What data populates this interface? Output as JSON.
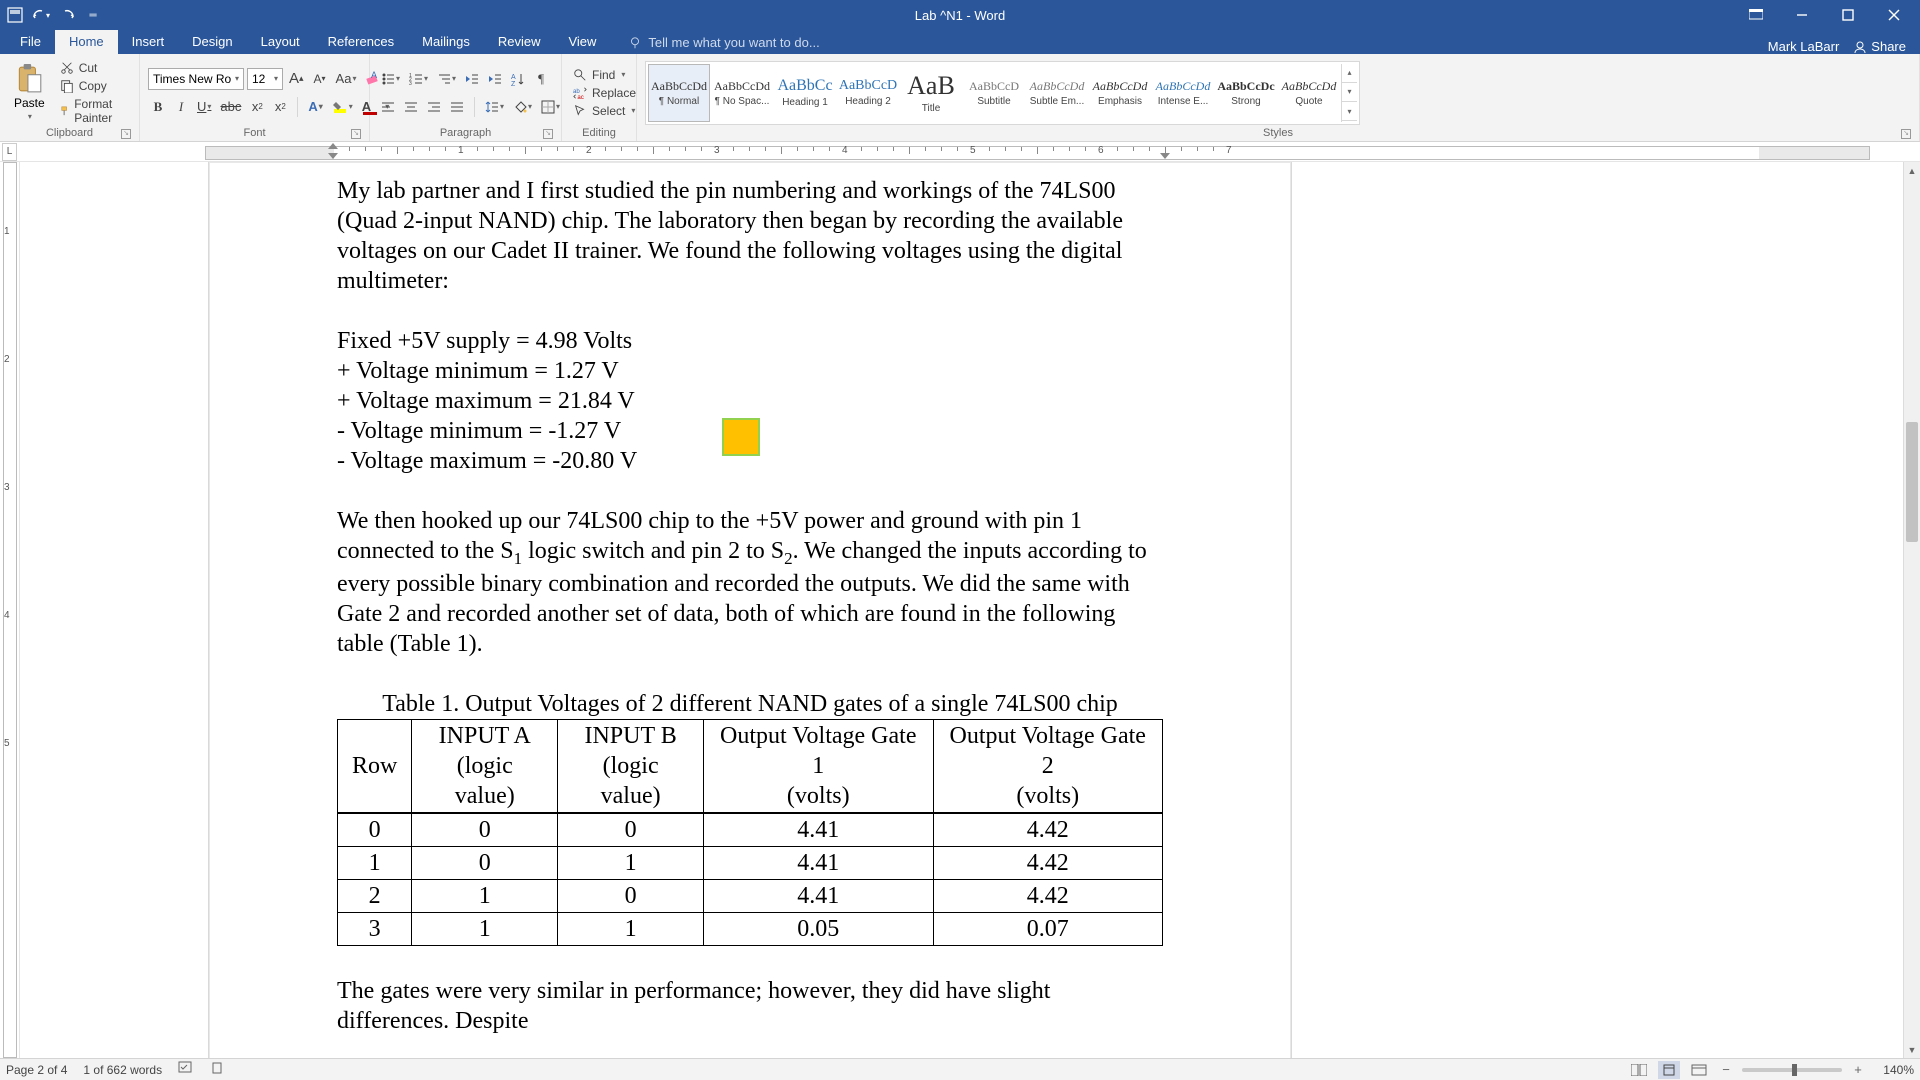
{
  "window": {
    "title": "Lab ^N1 - Word",
    "user": "Mark LaBarr",
    "share": "Share"
  },
  "tabs": [
    "File",
    "Home",
    "Insert",
    "Design",
    "Layout",
    "References",
    "Mailings",
    "Review",
    "View"
  ],
  "active_tab": "Home",
  "tell_me": "Tell me what you want to do...",
  "ribbon": {
    "clipboard": {
      "label": "Clipboard",
      "paste": "Paste",
      "cut": "Cut",
      "copy": "Copy",
      "format_painter": "Format Painter"
    },
    "font": {
      "label": "Font",
      "name": "Times New Ro",
      "size": "12"
    },
    "paragraph": {
      "label": "Paragraph"
    },
    "editing": {
      "label": "Editing",
      "find": "Find",
      "replace": "Replace",
      "select": "Select"
    },
    "styles": {
      "label": "Styles",
      "items": [
        {
          "preview": "AaBbCcDd",
          "name": "¶ Normal",
          "size": "12px",
          "color": "#333"
        },
        {
          "preview": "AaBbCcDd",
          "name": "¶ No Spac...",
          "size": "12px",
          "color": "#333"
        },
        {
          "preview": "AaBbCc",
          "name": "Heading 1",
          "size": "16px",
          "color": "#2e74b5"
        },
        {
          "preview": "AaBbCcD",
          "name": "Heading 2",
          "size": "14px",
          "color": "#2e74b5"
        },
        {
          "preview": "AaB",
          "name": "Title",
          "size": "26px",
          "color": "#333"
        },
        {
          "preview": "AaBbCcD",
          "name": "Subtitle",
          "size": "12px",
          "color": "#777"
        },
        {
          "preview": "AaBbCcDd",
          "name": "Subtle Em...",
          "size": "12px",
          "color": "#777",
          "italic": true
        },
        {
          "preview": "AaBbCcDd",
          "name": "Emphasis",
          "size": "12px",
          "color": "#333",
          "italic": true
        },
        {
          "preview": "AaBbCcDd",
          "name": "Intense E...",
          "size": "12px",
          "color": "#2e74b5",
          "italic": true
        },
        {
          "preview": "AaBbCcDc",
          "name": "Strong",
          "size": "12px",
          "color": "#333",
          "bold": true
        },
        {
          "preview": "AaBbCcDd",
          "name": "Quote",
          "size": "12px",
          "color": "#333",
          "italic": true
        }
      ]
    }
  },
  "document": {
    "para1": "My lab partner and I first studied the pin numbering and workings of the 74LS00 (Quad 2-input NAND) chip. The laboratory then began by recording the available voltages on our Cadet II trainer. We found the following voltages using the digital multimeter:",
    "voltages": [
      "Fixed +5V supply = 4.98 Volts",
      "+ Voltage minimum = 1.27 V",
      "+ Voltage maximum = 21.84 V",
      "- Voltage minimum = -1.27 V",
      "- Voltage maximum = -20.80 V"
    ],
    "para2_a": "We then hooked up our 74LS00 chip to the +5V power and ground with pin 1 connected to the S",
    "para2_b": " logic switch and pin 2 to S",
    "para2_c": ". We changed the inputs according to every possible binary combination and recorded the outputs. We did the same with Gate 2 and recorded another set of data, both of which are found in the following table (Table 1).",
    "table_caption": "Table 1. Output Voltages of 2 different NAND gates of a single 74LS00 chip",
    "table_headers": {
      "row": "Row",
      "a1": "INPUT A",
      "a2": "(logic value)",
      "b1": "INPUT B",
      "b2": "(logic value)",
      "g1a": "Output Voltage Gate 1",
      "g1b": "(volts)",
      "g2a": "Output Voltage Gate 2",
      "g2b": "(volts)"
    },
    "table_rows": [
      {
        "row": "0",
        "a": "0",
        "b": "0",
        "g1": "4.41",
        "g2": "4.42"
      },
      {
        "row": "1",
        "a": "0",
        "b": "1",
        "g1": "4.41",
        "g2": "4.42"
      },
      {
        "row": "2",
        "a": "1",
        "b": "0",
        "g1": "4.41",
        "g2": "4.42"
      },
      {
        "row": "3",
        "a": "1",
        "b": "1",
        "g1": "0.05",
        "g2": "0.07"
      }
    ],
    "para3": "The gates were very similar in performance; however, they did have slight differences. Despite"
  },
  "status": {
    "page": "Page 2 of 4",
    "words": "1 of 662 words",
    "zoom": "140%"
  },
  "chart_data": {
    "type": "table",
    "title": "Table 1. Output Voltages of 2 different NAND gates of a single 74LS00 chip",
    "columns": [
      "Row",
      "INPUT A (logic value)",
      "INPUT B (logic value)",
      "Output Voltage Gate 1 (volts)",
      "Output Voltage Gate 2 (volts)"
    ],
    "rows": [
      [
        0,
        0,
        0,
        4.41,
        4.42
      ],
      [
        1,
        0,
        1,
        4.41,
        4.42
      ],
      [
        2,
        1,
        0,
        4.41,
        4.42
      ],
      [
        3,
        1,
        1,
        0.05,
        0.07
      ]
    ]
  }
}
